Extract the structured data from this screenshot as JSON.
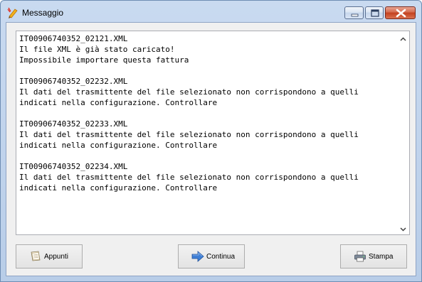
{
  "window": {
    "title": "Messaggio"
  },
  "message": {
    "text": "IT00906740352_02121.XML\nIl file XML è già stato caricato!\nImpossibile importare questa fattura\n\nIT00906740352_02232.XML\nIl dati del trasmittente del file selezionato non corrispondono a quelli\nindicati nella configurazione. Controllare\n\nIT00906740352_02233.XML\nIl dati del trasmittente del file selezionato non corrispondono a quelli\nindicati nella configurazione. Controllare\n\nIT00906740352_02234.XML\nIl dati del trasmittente del file selezionato non corrispondono a quelli\nindicati nella configurazione. Controllare"
  },
  "buttons": {
    "appunti": "Appunti",
    "continua": "Continua",
    "stampa": "Stampa"
  },
  "icons": {
    "window": "pen-icon",
    "appunti": "clipboard-icon",
    "continua": "arrow-right-icon",
    "stampa": "printer-icon"
  }
}
